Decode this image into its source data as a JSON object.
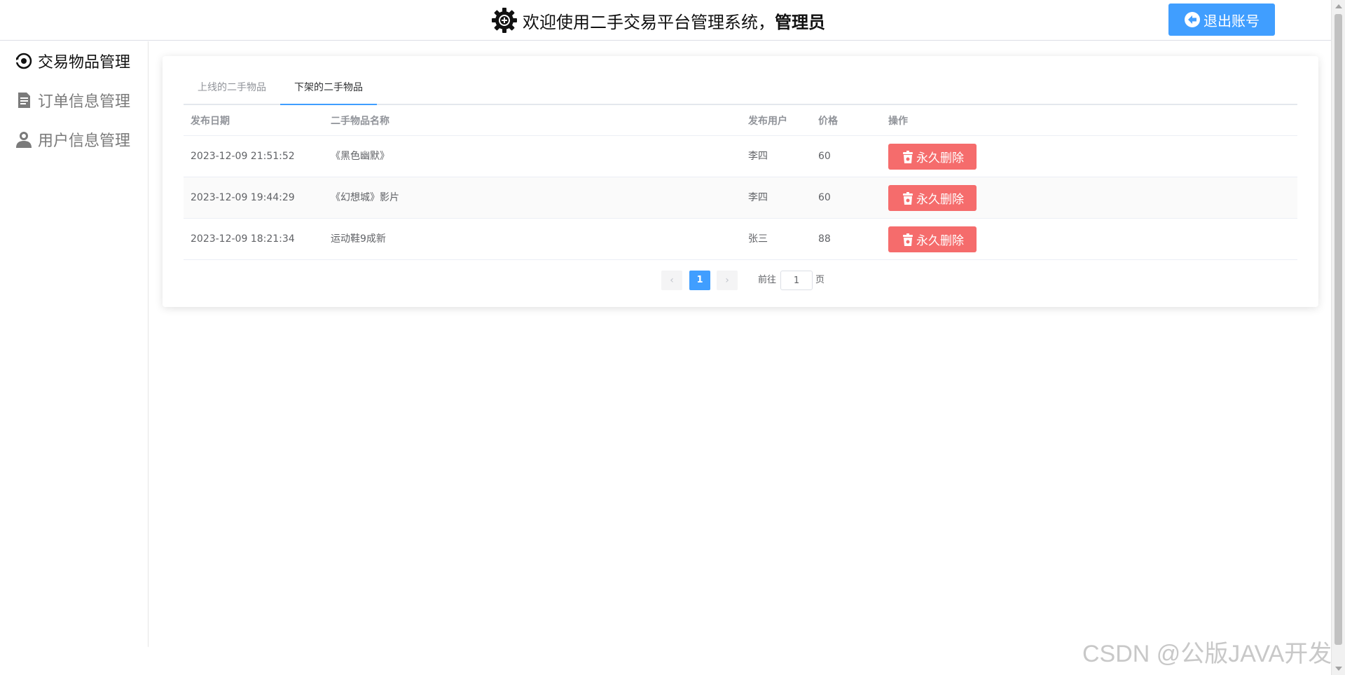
{
  "header": {
    "title": "欢迎使用二手交易平台管理系统，",
    "role": "管理员",
    "logout_label": "退出账号",
    "accent_color": "#409eff"
  },
  "sidebar": {
    "items": [
      {
        "label": "交易物品管理",
        "icon": "goods-icon",
        "active": true
      },
      {
        "label": "订单信息管理",
        "icon": "document-icon",
        "active": false
      },
      {
        "label": "用户信息管理",
        "icon": "user-icon",
        "active": false
      }
    ]
  },
  "tabs": [
    {
      "label": "上线的二手物品",
      "active": false
    },
    {
      "label": "下架的二手物品",
      "active": true
    }
  ],
  "table": {
    "columns": [
      "发布日期",
      "二手物品名称",
      "发布用户",
      "价格",
      "操作"
    ],
    "rows": [
      {
        "date": "2023-12-09 21:51:52",
        "name": "《黑色幽默》",
        "user": "李四",
        "price": "60",
        "action": "永久删除"
      },
      {
        "date": "2023-12-09 19:44:29",
        "name": "《幻想城》影片",
        "user": "李四",
        "price": "60",
        "action": "永久删除"
      },
      {
        "date": "2023-12-09 18:21:34",
        "name": "运动鞋9成新",
        "user": "张三",
        "price": "88",
        "action": "永久删除"
      }
    ],
    "delete_color": "#f56c6c"
  },
  "pagination": {
    "current_page": "1",
    "goto_label": "前往",
    "goto_value": "1",
    "page_suffix": "页"
  },
  "watermark": "CSDN @公版JAVA开发"
}
